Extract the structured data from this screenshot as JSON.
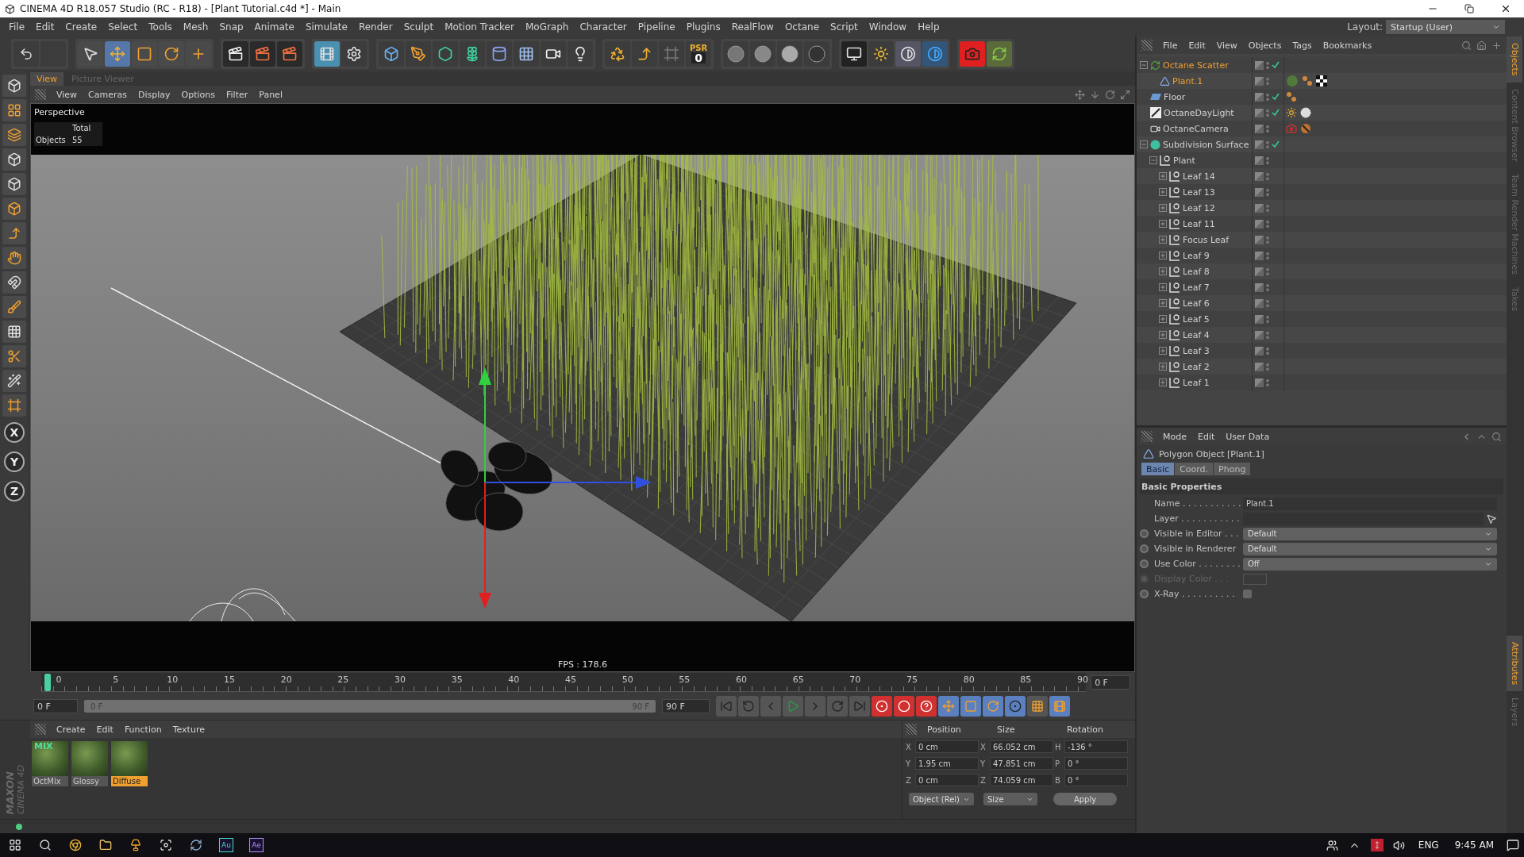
{
  "window": {
    "title": "CINEMA 4D R18.057 Studio (RC - R18) - [Plant Tutorial.c4d *] - Main"
  },
  "menu": [
    "File",
    "Edit",
    "Create",
    "Select",
    "Tools",
    "Mesh",
    "Snap",
    "Animate",
    "Simulate",
    "Render",
    "Sculpt",
    "Motion Tracker",
    "MoGraph",
    "Character",
    "Pipeline",
    "Plugins",
    "RealFlow",
    "Octane",
    "Script",
    "Window",
    "Help"
  ],
  "layout": {
    "label": "Layout:",
    "value": "Startup (User)"
  },
  "psr": {
    "label": "PSR",
    "value": "0"
  },
  "axis_buttons": [
    "X",
    "Y",
    "Z"
  ],
  "logo": {
    "brand": "MAXON",
    "product": "CINEMA 4D"
  },
  "viewport": {
    "tabs": [
      {
        "label": "View",
        "selected": true
      },
      {
        "label": "Picture Viewer",
        "selected": false
      }
    ],
    "menu": [
      "View",
      "Cameras",
      "Display",
      "Options",
      "Filter",
      "Panel"
    ],
    "camera": "Perspective",
    "stats": {
      "header": "Total",
      "label": "Objects",
      "value": "55"
    },
    "fps": "FPS : 178.6"
  },
  "timeline": {
    "ticks": [
      "0",
      "5",
      "10",
      "15",
      "20",
      "25",
      "30",
      "35",
      "40",
      "45",
      "50",
      "55",
      "60",
      "65",
      "70",
      "75",
      "80",
      "85",
      "90"
    ],
    "playhead": {
      "level": 0
    },
    "current": "0 F",
    "start": "0 F",
    "range": {
      "level": 1
    },
    "range_start": "0 F",
    "range_end": "90 F",
    "end": "90 F"
  },
  "materials": {
    "menu": [
      "Create",
      "Edit",
      "Function",
      "Texture"
    ],
    "items": [
      {
        "name": "OctMix",
        "badge": "MIX",
        "selected": false
      },
      {
        "name": "Glossy",
        "selected": false
      },
      {
        "name": "Diffuse",
        "selected": true
      }
    ]
  },
  "coordinates": {
    "headers": [
      "Position",
      "Size",
      "Rotation"
    ],
    "rows": [
      {
        "pos_axis": "X",
        "position": "0 cm",
        "size_axis": "X",
        "size": "66.052 cm",
        "rot_axis": "H",
        "rotation": "-136 °"
      },
      {
        "pos_axis": "Y",
        "position": "1.95 cm",
        "size_axis": "Y",
        "size": "47.851 cm",
        "rot_axis": "P",
        "rotation": "0 °"
      },
      {
        "pos_axis": "Z",
        "position": "0 cm",
        "size_axis": "Z",
        "size": "74.059 cm",
        "rot_axis": "B",
        "rotation": "0 °"
      }
    ],
    "mode": "Object (Rel)",
    "size_mode": "Size",
    "apply": "Apply"
  },
  "objects": {
    "menu": [
      "File",
      "Edit",
      "View",
      "Objects",
      "Tags",
      "Bookmarks"
    ],
    "tree": [
      {
        "name": "Octane Scatter",
        "kind": "scatter",
        "selected": true,
        "enabled": true,
        "expanded": true,
        "children": [
          {
            "name": "Plant.1",
            "kind": "polygon",
            "selected": true,
            "enabled": false
          }
        ]
      },
      {
        "name": "Floor",
        "kind": "floor",
        "selected": false,
        "enabled": true
      },
      {
        "name": "OctaneDayLight",
        "kind": "light",
        "selected": false,
        "enabled": true
      },
      {
        "name": "OctaneCamera",
        "kind": "camera",
        "selected": false,
        "enabled": false
      },
      {
        "name": "Subdivision Surface",
        "kind": "subdivision",
        "selected": false,
        "enabled": true,
        "expanded": true,
        "children": [
          {
            "name": "Plant",
            "kind": "null",
            "selected": false,
            "enabled": false,
            "expanded": true,
            "children": [
              {
                "name": "Leaf 14",
                "kind": "null",
                "selected": false,
                "enabled": false,
                "expanded": false
              },
              {
                "name": "Leaf 13",
                "kind": "null",
                "selected": false,
                "enabled": false,
                "expanded": false
              },
              {
                "name": "Leaf 12",
                "kind": "null",
                "selected": false,
                "enabled": false,
                "expanded": false
              },
              {
                "name": "Leaf 11",
                "kind": "null",
                "selected": false,
                "enabled": false,
                "expanded": false
              },
              {
                "name": "Focus Leaf",
                "kind": "null",
                "selected": false,
                "enabled": false,
                "expanded": false
              },
              {
                "name": "Leaf 9",
                "kind": "null",
                "selected": false,
                "enabled": false,
                "expanded": false
              },
              {
                "name": "Leaf 8",
                "kind": "null",
                "selected": false,
                "enabled": false,
                "expanded": false
              },
              {
                "name": "Leaf 7",
                "kind": "null",
                "selected": false,
                "enabled": false,
                "expanded": false
              },
              {
                "name": "Leaf 6",
                "kind": "null",
                "selected": false,
                "enabled": false,
                "expanded": false
              },
              {
                "name": "Leaf 5",
                "kind": "null",
                "selected": false,
                "enabled": false,
                "expanded": false
              },
              {
                "name": "Leaf 4",
                "kind": "null",
                "selected": false,
                "enabled": false,
                "expanded": false
              },
              {
                "name": "Leaf 3",
                "kind": "null",
                "selected": false,
                "enabled": false,
                "expanded": false
              },
              {
                "name": "Leaf 2",
                "kind": "null",
                "selected": false,
                "enabled": false,
                "expanded": false
              },
              {
                "name": "Leaf 1",
                "kind": "null",
                "selected": false,
                "enabled": false,
                "expanded": false
              }
            ]
          }
        ]
      }
    ]
  },
  "side_tabs_top": [
    {
      "label": "Objects",
      "selected": true
    },
    {
      "label": "Content Browser",
      "selected": false
    },
    {
      "label": "Team Render Machines",
      "selected": false
    },
    {
      "label": "Takes",
      "selected": false
    }
  ],
  "attributes": {
    "menu": [
      "Mode",
      "Edit",
      "User Data"
    ],
    "title": "Polygon Object [Plant.1]",
    "tabs": [
      {
        "label": "Basic",
        "selected": true
      },
      {
        "label": "Coord.",
        "selected": false
      },
      {
        "label": "Phong",
        "selected": false
      }
    ],
    "section": "Basic Properties",
    "fields": [
      {
        "kind": "text",
        "label": "Name . . . . . . . . . . .",
        "value": "Plant.1",
        "disabled": false
      },
      {
        "kind": "link",
        "label": "Layer . . . . . . . . . . .",
        "disabled": false
      },
      {
        "kind": "select",
        "label": "Visible in Editor . . .",
        "value": "Default",
        "disabled": false,
        "animated": false
      },
      {
        "kind": "select",
        "label": "Visible in Renderer",
        "value": "Default",
        "disabled": false,
        "animated": false
      },
      {
        "kind": "select",
        "label": "Use Color . . . . . . . .",
        "value": "Off",
        "disabled": false,
        "animated": false
      },
      {
        "kind": "color",
        "label": "Display Color . . .",
        "disabled": true,
        "animated": false
      },
      {
        "kind": "checkbox",
        "label": "X-Ray . . . . . . . . . .",
        "checked": false,
        "disabled": false,
        "animated": false
      }
    ]
  },
  "side_tabs_bottom": [
    {
      "label": "Attributes",
      "selected": true
    },
    {
      "label": "Layers",
      "selected": false
    }
  ],
  "taskbar": {
    "apps": [
      "Au",
      "Ae"
    ],
    "language": "ENG",
    "time": "9:45 AM"
  }
}
